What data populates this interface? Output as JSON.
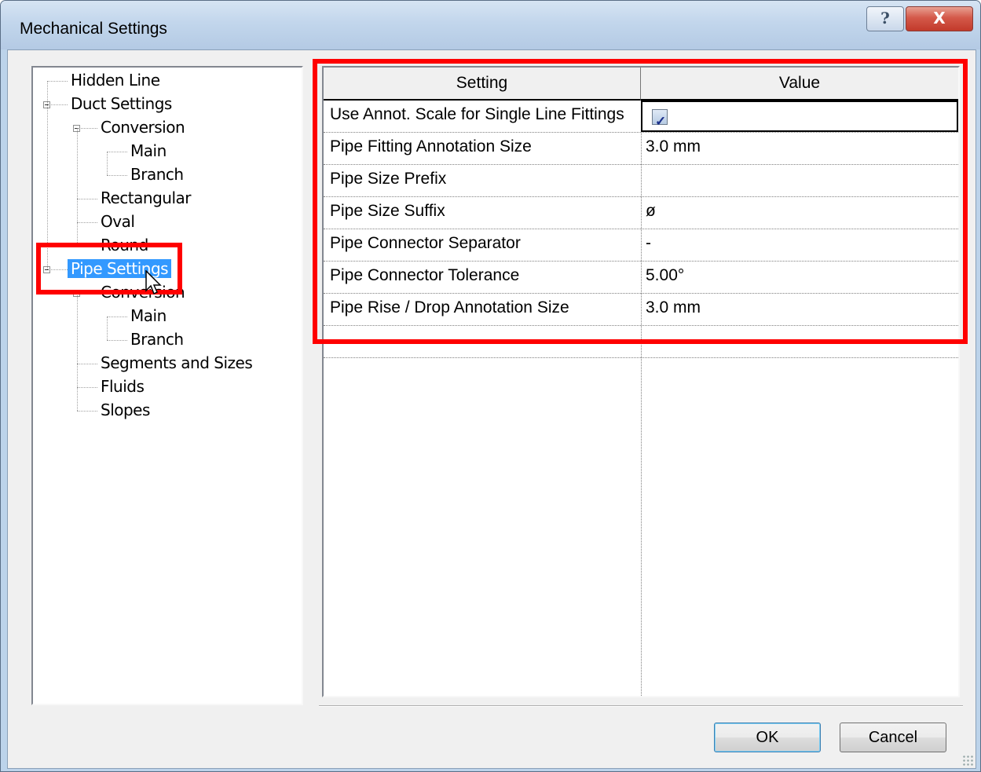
{
  "window": {
    "title": "Mechanical Settings",
    "help_glyph": "?",
    "close_glyph": "X"
  },
  "tree": {
    "items": [
      {
        "label": "Hidden Line",
        "level": 0
      },
      {
        "label": "Duct Settings",
        "level": 0,
        "expanded": true
      },
      {
        "label": "Conversion",
        "level": 1,
        "expanded": true
      },
      {
        "label": "Main",
        "level": 2
      },
      {
        "label": "Branch",
        "level": 2
      },
      {
        "label": "Rectangular",
        "level": 1
      },
      {
        "label": "Oval",
        "level": 1
      },
      {
        "label": "Round",
        "level": 1
      },
      {
        "label": "Pipe Settings",
        "level": 0,
        "expanded": true,
        "selected": true
      },
      {
        "label": "Conversion",
        "level": 1,
        "expanded": true
      },
      {
        "label": "Main",
        "level": 2
      },
      {
        "label": "Branch",
        "level": 2
      },
      {
        "label": "Segments and Sizes",
        "level": 1
      },
      {
        "label": "Fluids",
        "level": 1
      },
      {
        "label": "Slopes",
        "level": 1
      }
    ]
  },
  "grid": {
    "headers": {
      "setting": "Setting",
      "value": "Value"
    },
    "rows": [
      {
        "setting": "Use Annot. Scale for Single Line Fittings",
        "value": "",
        "checkbox": true,
        "checked": true
      },
      {
        "setting": "Pipe Fitting Annotation Size",
        "value": "3.0 mm"
      },
      {
        "setting": "Pipe Size Prefix",
        "value": ""
      },
      {
        "setting": "Pipe Size Suffix",
        "value": "ø"
      },
      {
        "setting": "Pipe Connector Separator",
        "value": "-"
      },
      {
        "setting": "Pipe Connector Tolerance",
        "value": "5.00°"
      },
      {
        "setting": "Pipe Rise / Drop Annotation Size",
        "value": "3.0 mm"
      }
    ]
  },
  "buttons": {
    "ok": "OK",
    "cancel": "Cancel"
  },
  "colors": {
    "highlight": "#ff0000",
    "selection": "#3399ff"
  },
  "icons": {
    "cursor": "arrow-cursor-icon",
    "checkbox": "checkmark-icon"
  }
}
